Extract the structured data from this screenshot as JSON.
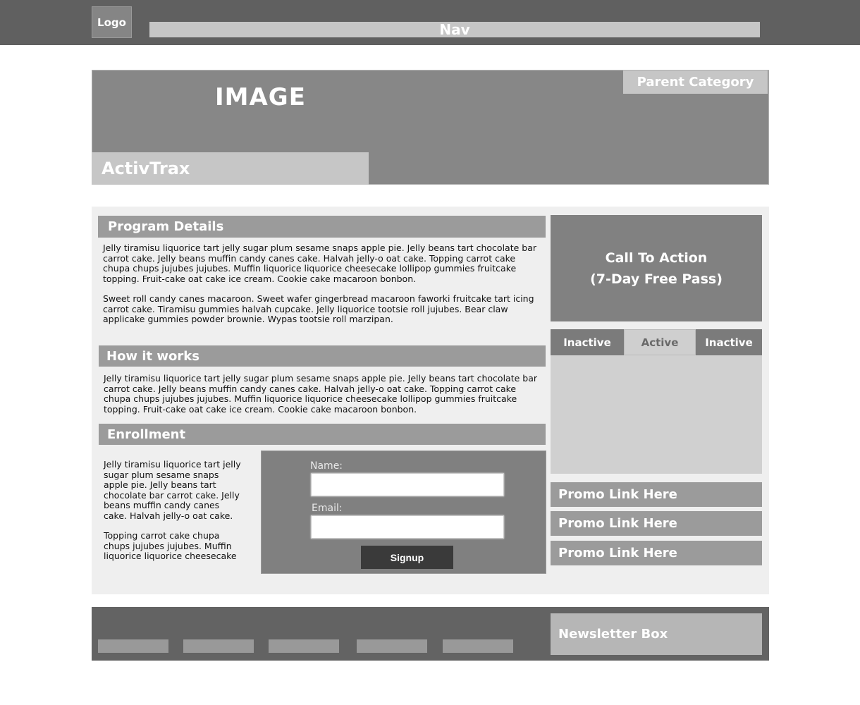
{
  "header": {
    "logo": "Logo",
    "nav": "Nav"
  },
  "hero": {
    "image_label": "IMAGE",
    "parent_category": "Parent Category",
    "title": "ActivTrax"
  },
  "sections": {
    "program_details": {
      "heading": "Program Details",
      "paragraphs": [
        "Jelly tiramisu liquorice tart jelly sugar plum sesame snaps apple pie. Jelly beans tart chocolate bar carrot cake. Jelly beans muffin candy canes cake. Halvah jelly-o oat cake. Topping carrot cake chupa chups jujubes jujubes. Muffin liquorice liquorice cheesecake lollipop gummies fruitcake topping. Fruit-cake oat cake ice cream. Cookie cake macaroon bonbon.",
        "Sweet roll candy canes macaroon. Sweet wafer gingerbread macaroon faworki fruitcake tart icing carrot cake. Tiramisu gummies halvah cupcake. Jelly liquorice tootsie roll jujubes. Bear claw applicake gummies powder brownie. Wypas tootsie roll marzipan."
      ]
    },
    "how_it_works": {
      "heading": "How it works",
      "paragraph": "Jelly tiramisu liquorice tart jelly sugar plum sesame snaps apple pie. Jelly beans tart chocolate bar carrot cake. Jelly beans muffin candy canes cake. Halvah jelly-o oat cake. Topping carrot cake chupa chups jujubes jujubes. Muffin liquorice liquorice cheesecake lollipop gummies fruitcake topping. Fruit-cake oat cake ice cream. Cookie cake macaroon bonbon."
    },
    "enrollment": {
      "heading": "Enrollment",
      "paragraphs": [
        "Jelly tiramisu liquorice tart jelly sugar plum sesame snaps apple pie. Jelly beans tart chocolate bar carrot cake. Jelly beans muffin candy canes cake. Halvah jelly-o oat cake.",
        "Topping carrot cake chupa chups jujubes jujubes. Muffin liquorice liquorice cheesecake"
      ],
      "form": {
        "name_label": "Name:",
        "name_value": "",
        "email_label": "Email:",
        "email_value": "",
        "signup_label": "Signup"
      }
    }
  },
  "sidebar": {
    "cta_line1": "Call To Action",
    "cta_line2": "(7-Day Free Pass)",
    "tabs": [
      {
        "label": "Inactive",
        "state": "inactive"
      },
      {
        "label": "Active",
        "state": "active"
      },
      {
        "label": "Inactive",
        "state": "inactive"
      }
    ],
    "promos": [
      "Promo Link Here",
      "Promo Link Here",
      "Promo Link Here"
    ]
  },
  "footer": {
    "link_count_visible": 5,
    "newsletter": "Newsletter Box"
  }
}
